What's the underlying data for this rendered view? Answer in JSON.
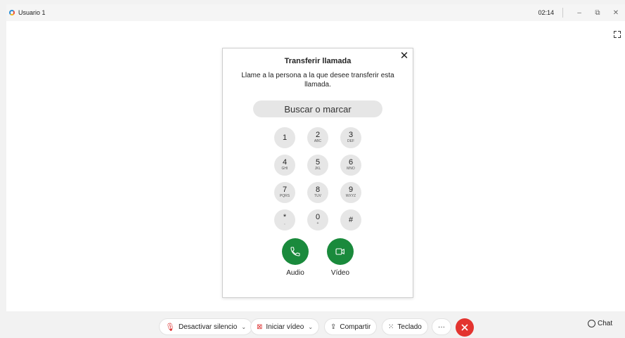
{
  "window": {
    "title": "Usuario 1",
    "time": "02:14",
    "minimize_glyph": "–",
    "restore_glyph": "⧉",
    "close_glyph": "✕"
  },
  "dialog": {
    "title": "Transferir llamada",
    "description": "Llame a la persona a la que desee transferir esta llamada.",
    "search_value": "Buscar o marcar",
    "close_glyph": "✕",
    "keypad": [
      {
        "digit": "1",
        "letters": ""
      },
      {
        "digit": "2",
        "letters": "ABC"
      },
      {
        "digit": "3",
        "letters": "DEF"
      },
      {
        "digit": "4",
        "letters": "GHI"
      },
      {
        "digit": "5",
        "letters": "JKL"
      },
      {
        "digit": "6",
        "letters": "MNO"
      },
      {
        "digit": "7",
        "letters": "PQRS"
      },
      {
        "digit": "8",
        "letters": "TUV"
      },
      {
        "digit": "9",
        "letters": "WXYZ"
      },
      {
        "digit": "*",
        "letters": ","
      },
      {
        "digit": "0",
        "letters": "+"
      },
      {
        "digit": "#",
        "letters": ""
      }
    ],
    "audio_label": "Audio",
    "video_label": "Vídeo"
  },
  "toolbar": {
    "mute_label": "Desactivar silencio",
    "video_label": "Iniciar vídeo",
    "share_label": "Compartir",
    "keypad_label": "Teclado",
    "more_label": "···",
    "chat_label": "Chat",
    "chevron": "⌄"
  },
  "colors": {
    "call_green": "#1a8a3c",
    "end_red": "#e3342f",
    "mute_red": "#d33333"
  }
}
